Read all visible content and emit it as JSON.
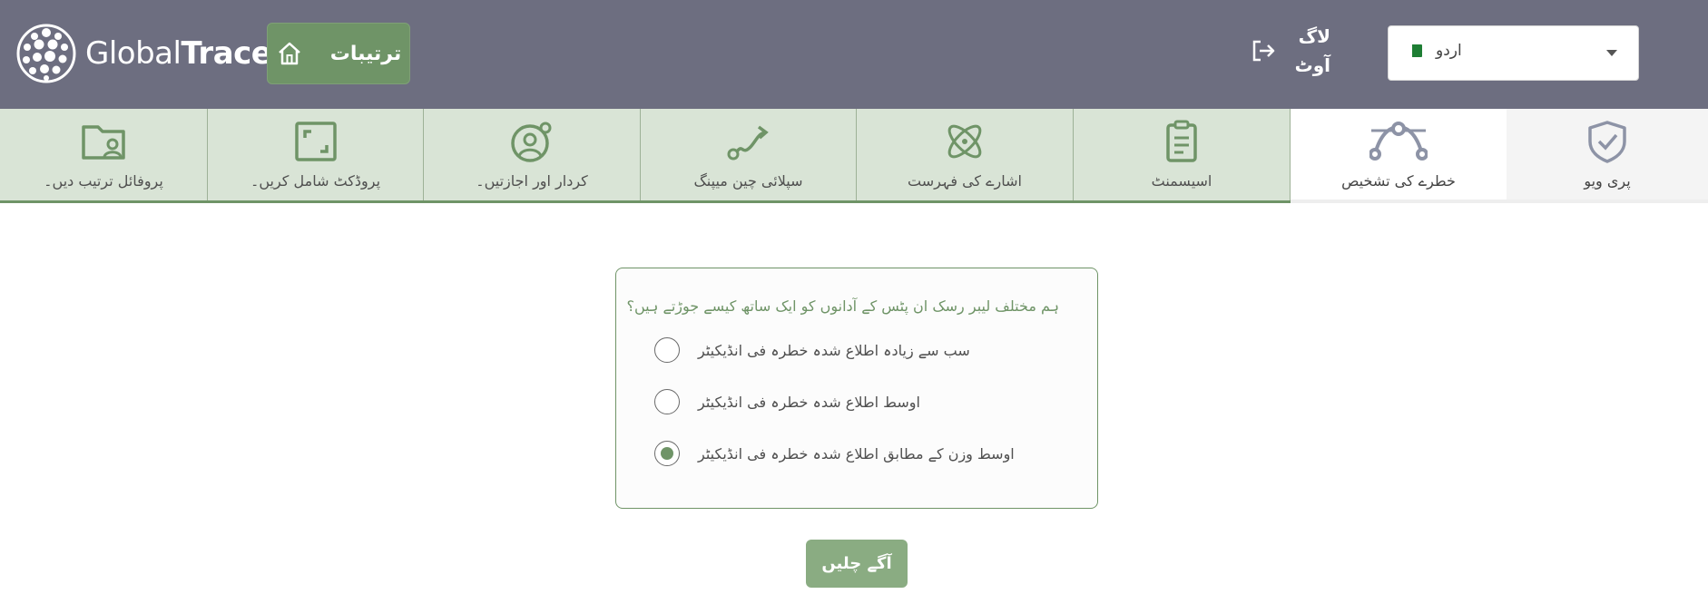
{
  "header": {
    "logo_light": "Global",
    "logo_bold": "Trace",
    "settings_label": "ترتیبات",
    "logout_label": "لاگ آوٹ",
    "language": "اردو"
  },
  "tabs": [
    {
      "label": "پروفائل ترتیب دیں۔",
      "icon": "folder-user-icon"
    },
    {
      "label": "پروڈکٹ شامل کریں۔",
      "icon": "expand-frame-icon"
    },
    {
      "label": "کردار اور اجازتیں۔",
      "icon": "user-gear-icon"
    },
    {
      "label": "سپلائی چین میپنگ",
      "icon": "route-icon"
    },
    {
      "label": "اشارے کی فہرست",
      "icon": "atom-icon"
    },
    {
      "label": "اسیسمنٹ",
      "icon": "clipboard-icon"
    },
    {
      "label": "خطرے کی تشخیص",
      "icon": "bezier-curve-icon"
    },
    {
      "label": "پری ویو",
      "icon": "shield-check-icon"
    }
  ],
  "question": {
    "text": "ہم مختلف لیبر رسک ان پٹس کے آدانوں کو ایک ساتھ کیسے جوڑتے ہیں؟",
    "options": [
      {
        "label": "سب سے زیادہ اطلاع شدہ خطرہ فی انڈیکیٹر",
        "selected": false
      },
      {
        "label": "اوسط اطلاع شدہ خطرہ فی انڈیکیٹر",
        "selected": false
      },
      {
        "label": "اوسط وزن کے مطابق اطلاع شدہ خطرہ فی انڈیکیٹر",
        "selected": true
      }
    ]
  },
  "next_label": "آگے چلیں",
  "colors": {
    "header_bg": "#6d6e80",
    "accent_green": "#6f9467",
    "tab_bg": "#d9e4d6",
    "next_btn": "#8aac82"
  }
}
